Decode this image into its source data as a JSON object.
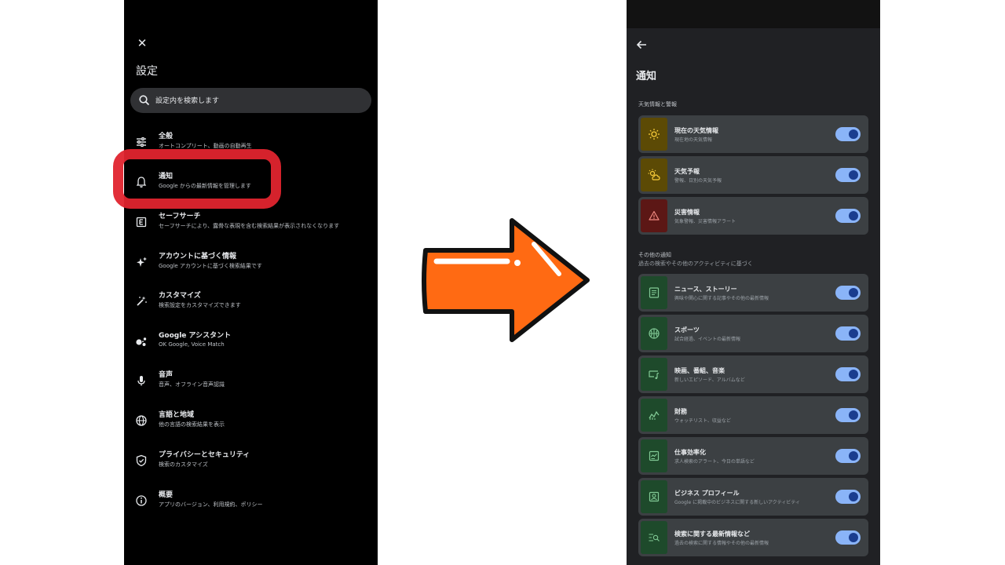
{
  "left_screen": {
    "title": "設定",
    "search_placeholder": "設定内を検索します",
    "items": [
      {
        "label": "全般",
        "sub": "オートコンプリート、動画の自動再生",
        "icon": "tune-icon"
      },
      {
        "label": "通知",
        "sub": "Google からの最新情報を管理します",
        "icon": "bell-icon"
      },
      {
        "label": "セーフサーチ",
        "sub": "セーフサーチにより、露骨な表現を含む検索結果が表示されなくなります",
        "icon": "safesearch-icon"
      },
      {
        "label": "アカウントに基づく情報",
        "sub": "Google アカウントに基づく検索結果です",
        "icon": "sparkle-icon"
      },
      {
        "label": "カスタマイズ",
        "sub": "検索設定をカスタマイズできます",
        "icon": "magic-wand-icon"
      },
      {
        "label": "Google アシスタント",
        "sub": "OK Google, Voice Match",
        "icon": "assistant-icon"
      },
      {
        "label": "音声",
        "sub": "音声、オフライン音声認識",
        "icon": "mic-icon"
      },
      {
        "label": "言語と地域",
        "sub": "他の言語の検索結果を表示",
        "icon": "globe-icon"
      },
      {
        "label": "プライバシーとセキュリティ",
        "sub": "検索のカスタマイズ",
        "icon": "shield-icon"
      },
      {
        "label": "概要",
        "sub": "アプリのバージョン、利用規約、ポリシー",
        "icon": "info-icon"
      }
    ],
    "highlighted_item": "通知",
    "highlight_color": "#e0242e"
  },
  "arrow": {
    "fill": "#ff6a13",
    "outline": "#111111"
  },
  "right_screen": {
    "title": "通知",
    "sections": [
      {
        "heading": "天気情報と警報",
        "subheading": "",
        "items": [
          {
            "label": "現在の天気情報",
            "sub": "現在地の天気情報",
            "icon": "sun-icon",
            "color": "#5c4a05",
            "icon_color": "#f9cc3a",
            "enabled": true
          },
          {
            "label": "天気予報",
            "sub": "警報、日別の天気予報",
            "icon": "partly-cloudy-icon",
            "color": "#5c4a05",
            "icon_color": "#f9cc3a",
            "enabled": true
          },
          {
            "label": "災害情報",
            "sub": "気象警報、災害情報アラート",
            "icon": "warning-icon",
            "color": "#5c1715",
            "icon_color": "#f28b82",
            "enabled": true
          }
        ]
      },
      {
        "heading": "その他の通知",
        "subheading": "過去の検索やその他のアクティビティに基づく",
        "items": [
          {
            "label": "ニュース、ストーリー",
            "sub": "興味や関心に関する記事やその他の最新情報",
            "icon": "article-icon",
            "color": "#1e4a2b",
            "icon_color": "#81c995",
            "enabled": true
          },
          {
            "label": "スポーツ",
            "sub": "試合経過、イベントの最新情報",
            "icon": "ball-icon",
            "color": "#1e4a2b",
            "icon_color": "#81c995",
            "enabled": true
          },
          {
            "label": "映画、番組、音楽",
            "sub": "新しいエピソード、アルバムなど",
            "icon": "tv-music-icon",
            "color": "#1e4a2b",
            "icon_color": "#81c995",
            "enabled": true
          },
          {
            "label": "財務",
            "sub": "ウォッチリスト、収益など",
            "icon": "chart-icon",
            "color": "#1e4a2b",
            "icon_color": "#81c995",
            "enabled": true
          },
          {
            "label": "仕事効率化",
            "sub": "求人検索のアラート、今日の単語など",
            "icon": "productivity-icon",
            "color": "#1e4a2b",
            "icon_color": "#81c995",
            "enabled": true
          },
          {
            "label": "ビジネス プロフィール",
            "sub": "Google に掲載中のビジネスに関する新しいアクティビティ",
            "icon": "profile-icon",
            "color": "#1e4a2b",
            "icon_color": "#81c995",
            "enabled": true
          },
          {
            "label": "検索に関する最新情報など",
            "sub": "過去の検索に関する情報やその他の最新情報",
            "icon": "search-list-icon",
            "color": "#1e4a2b",
            "icon_color": "#81c995",
            "enabled": true
          }
        ]
      }
    ]
  }
}
